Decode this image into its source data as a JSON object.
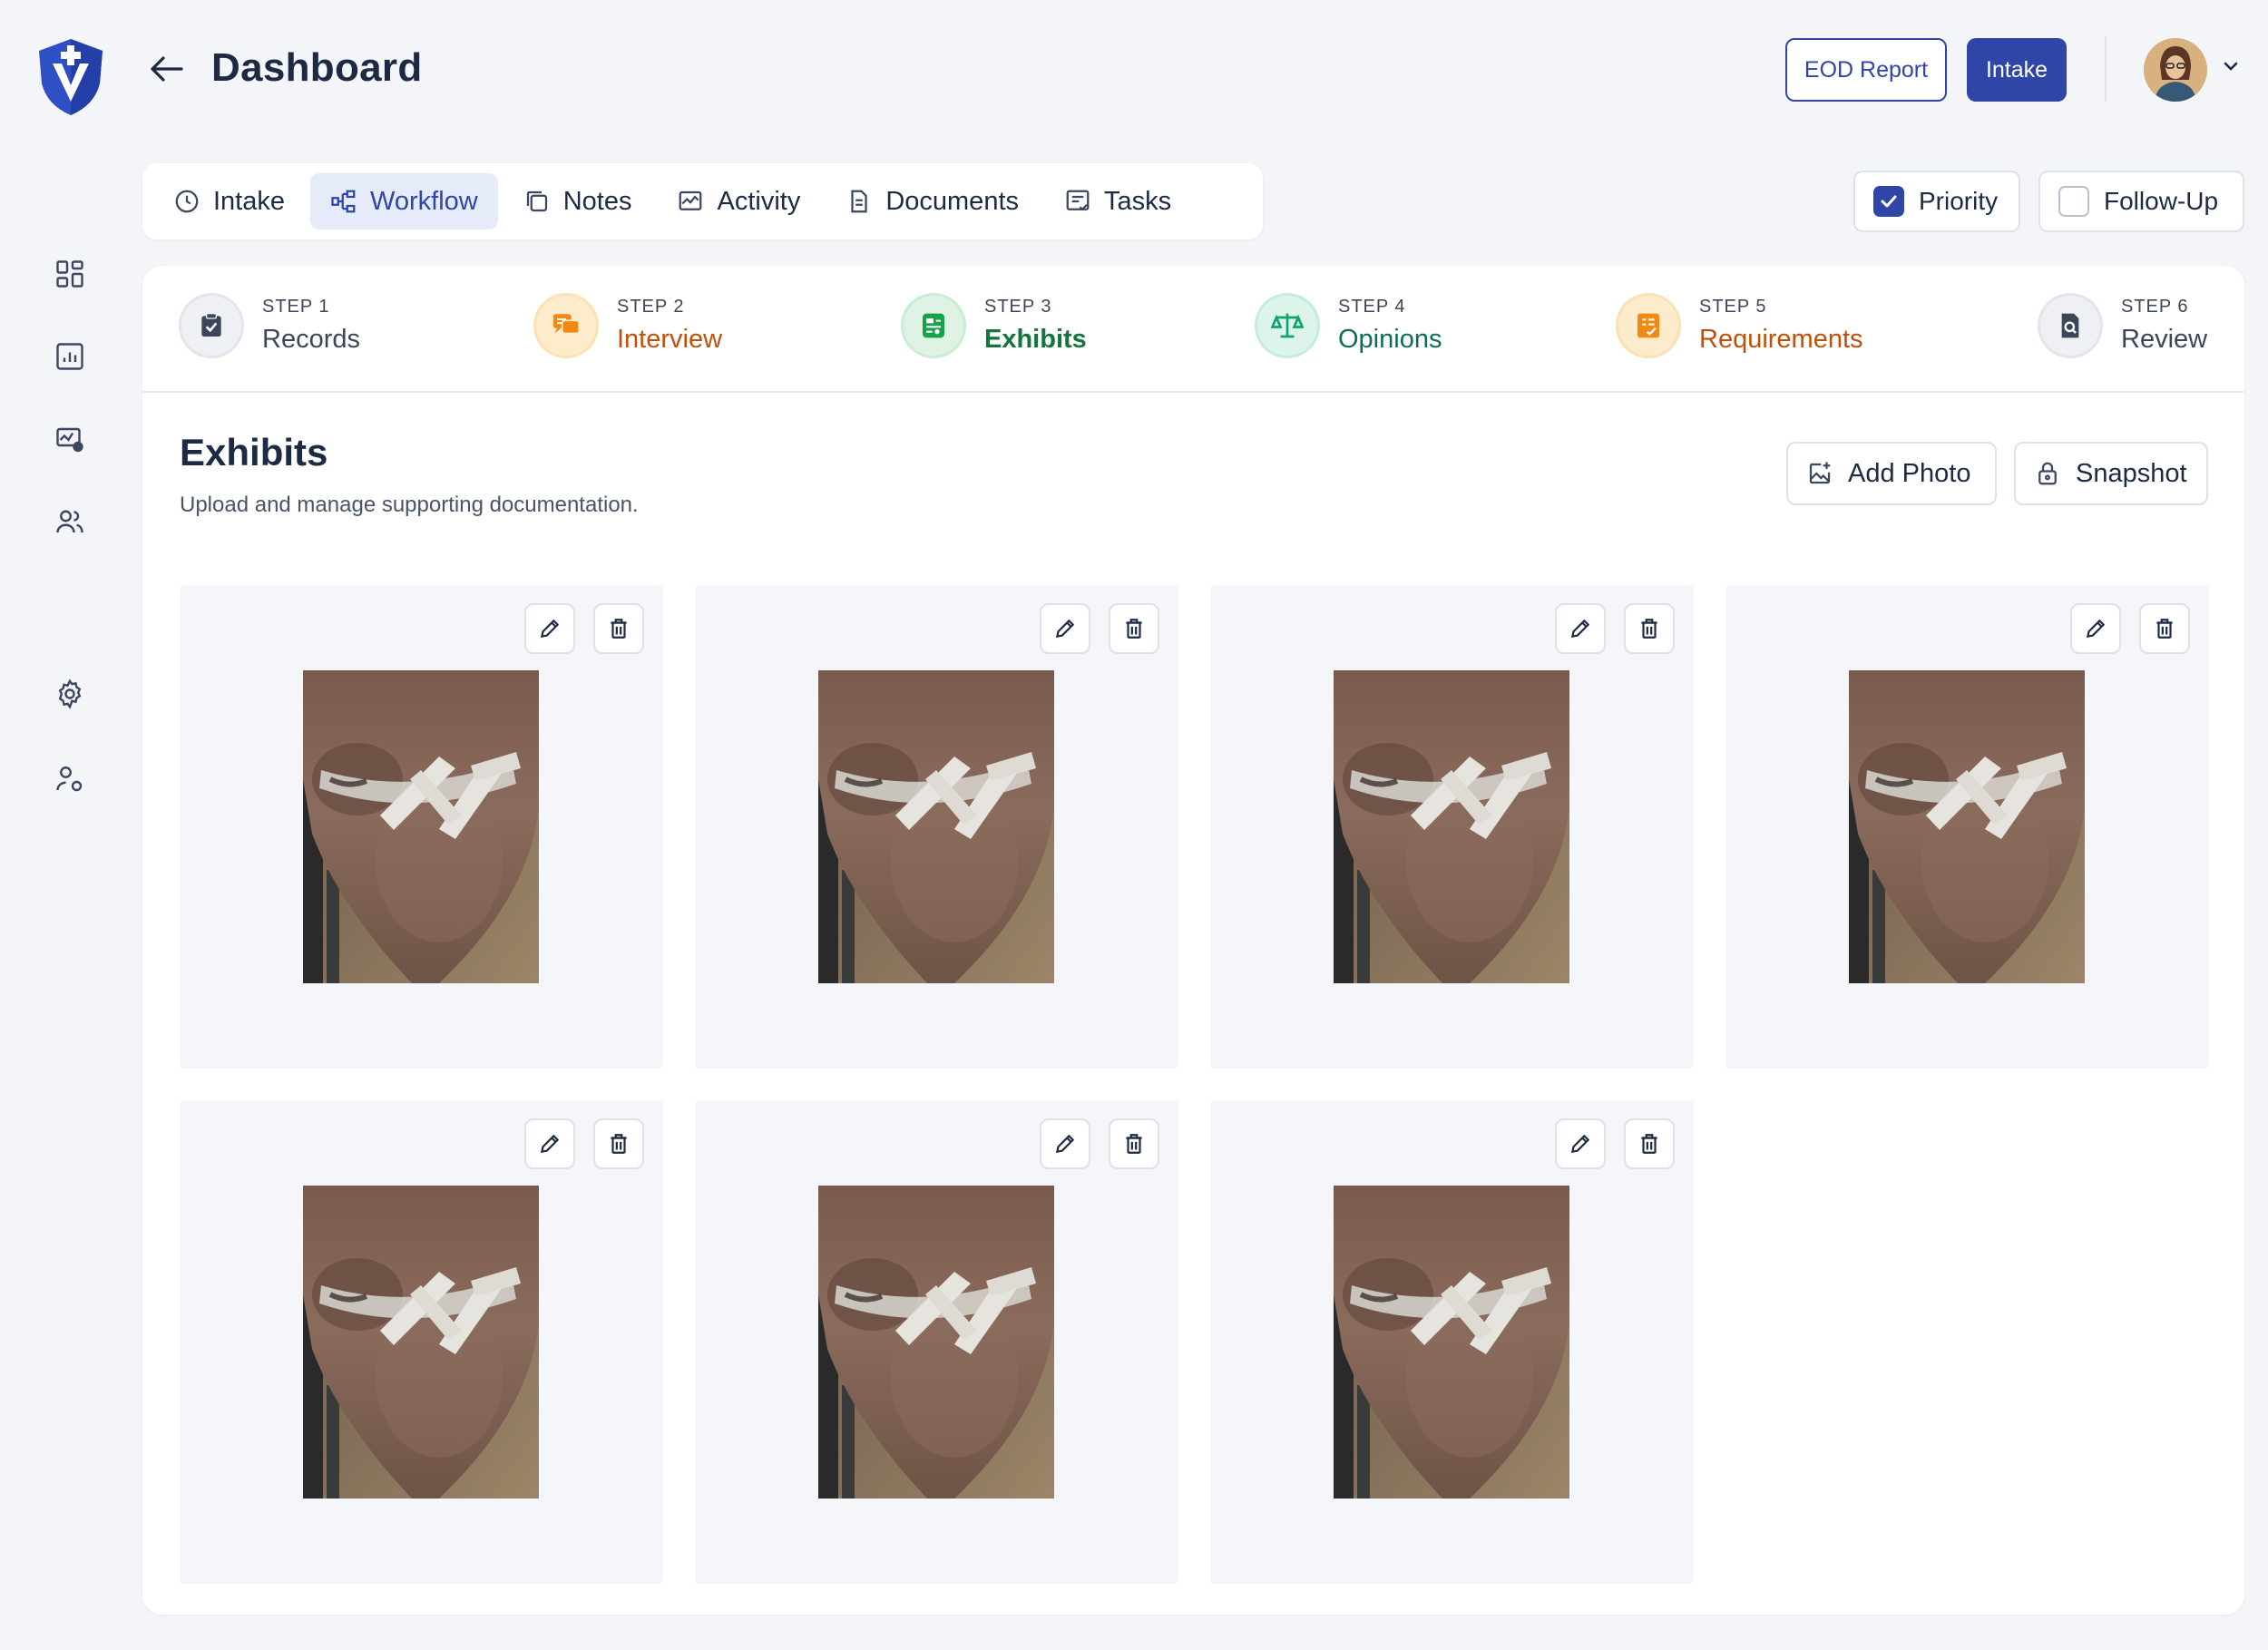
{
  "header": {
    "title": "Dashboard",
    "eod_label": "EOD Report",
    "intake_label": "Intake"
  },
  "colors": {
    "accent": "#2f45a8",
    "step_done": "#3c4659",
    "step_interview": "#c0510c",
    "step_exhibits": "#13743f",
    "step_opinions": "#0f6e52",
    "step_requirements": "#c0510c"
  },
  "rail": {
    "items": [
      {
        "icon": "grid-icon"
      },
      {
        "icon": "bar-chart-icon"
      },
      {
        "icon": "activity-monitor-icon"
      },
      {
        "icon": "users-icon"
      },
      {
        "icon": "gear-icon"
      },
      {
        "icon": "user-settings-icon"
      }
    ]
  },
  "tabs": [
    {
      "label": "Intake",
      "icon": "clock-icon"
    },
    {
      "label": "Workflow",
      "icon": "workflow-icon",
      "active": true
    },
    {
      "label": "Notes",
      "icon": "notes-icon"
    },
    {
      "label": "Activity",
      "icon": "activity-icon"
    },
    {
      "label": "Documents",
      "icon": "document-icon"
    },
    {
      "label": "Tasks",
      "icon": "tasks-icon"
    }
  ],
  "flags": {
    "priority_label": "Priority",
    "priority_checked": true,
    "followup_label": "Follow-Up",
    "followup_checked": false
  },
  "steps": [
    {
      "number": "STEP 1",
      "label": "Records",
      "icon": "clipboard-check-icon"
    },
    {
      "number": "STEP 2",
      "label": "Interview",
      "icon": "chat-icon"
    },
    {
      "number": "STEP 3",
      "label": "Exhibits",
      "icon": "exhibit-icon"
    },
    {
      "number": "STEP 4",
      "label": "Opinions",
      "icon": "scale-icon"
    },
    {
      "number": "STEP 5",
      "label": "Requirements",
      "icon": "checklist-icon"
    },
    {
      "number": "STEP 6",
      "label": "Review",
      "icon": "search-doc-icon"
    }
  ],
  "section": {
    "title": "Exhibits",
    "subtitle": "Upload and manage supporting documentation.",
    "add_photo_label": "Add Photo",
    "snapshot_label": "Snapshot"
  },
  "exhibits": {
    "count": 7,
    "photo_subject": "knee with tape strips"
  }
}
